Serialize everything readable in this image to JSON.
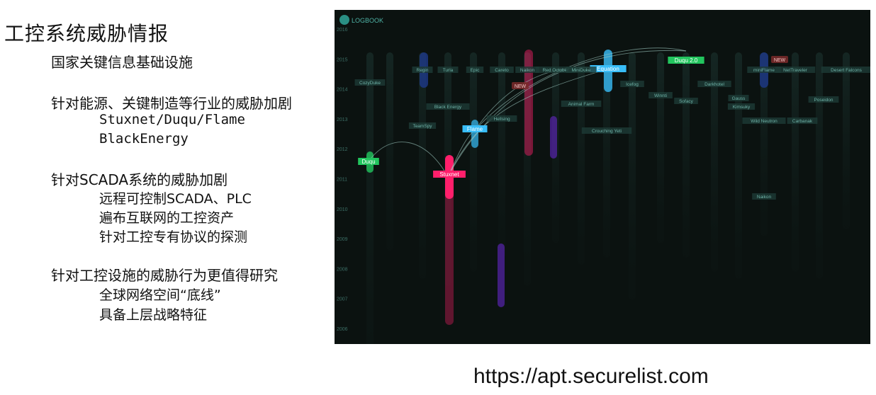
{
  "slide": {
    "title": "工控系统威胁情报",
    "sections": [
      {
        "heading": "国家关键信息基础设施",
        "items": []
      },
      {
        "heading": "针对能源、关键制造等行业的威胁加剧",
        "items": [
          "Stuxnet/Duqu/Flame",
          "BlackEnergy"
        ]
      },
      {
        "heading": "针对SCADA系统的威胁加剧",
        "items": [
          "远程可控制SCADA、PLC",
          "遍布互联网的工控资产",
          "针对工控专有协议的探测"
        ]
      },
      {
        "heading": "针对工控设施的威胁行为更值得研究",
        "items": [
          "全球网络空间“底线”",
          "具备上层战略特征"
        ]
      }
    ],
    "url": "https://apt.securelist.com"
  },
  "logbook": {
    "logo_text": "LOGBOOK",
    "years": [
      "2016",
      "2015",
      "2014",
      "2013",
      "2012",
      "2011",
      "2010",
      "2009",
      "2008",
      "2007",
      "2006"
    ],
    "highlight_labels": [
      "Duqu",
      "Stuxnet",
      "Flame",
      "Equation",
      "Duqu 2.0"
    ],
    "dim_labels": [
      "CozyDuke",
      "Regin",
      "Turla",
      "Epic",
      "Careto",
      "Naikon",
      "Red October",
      "MiniDuke",
      "Icefog",
      "Winnti",
      "Sofacy",
      "Darkhotel",
      "Gauss",
      "miniFlame",
      "NetTraveler",
      "Desert Falcons",
      "Poseidon",
      "Black Energy",
      "Hellsing",
      "Animal Farm",
      "Crouching Yeti",
      "Kimsuky",
      "Wild Neutron",
      "Carbanak",
      "Naikon",
      "TeamSpy"
    ],
    "new_badge": "NEW",
    "colors": {
      "highlight_green": "#22c55e",
      "stuxnet_pink": "#ff1f6b",
      "flame_cyan": "#38bdf8",
      "panel_bg": "#0b1210"
    }
  }
}
